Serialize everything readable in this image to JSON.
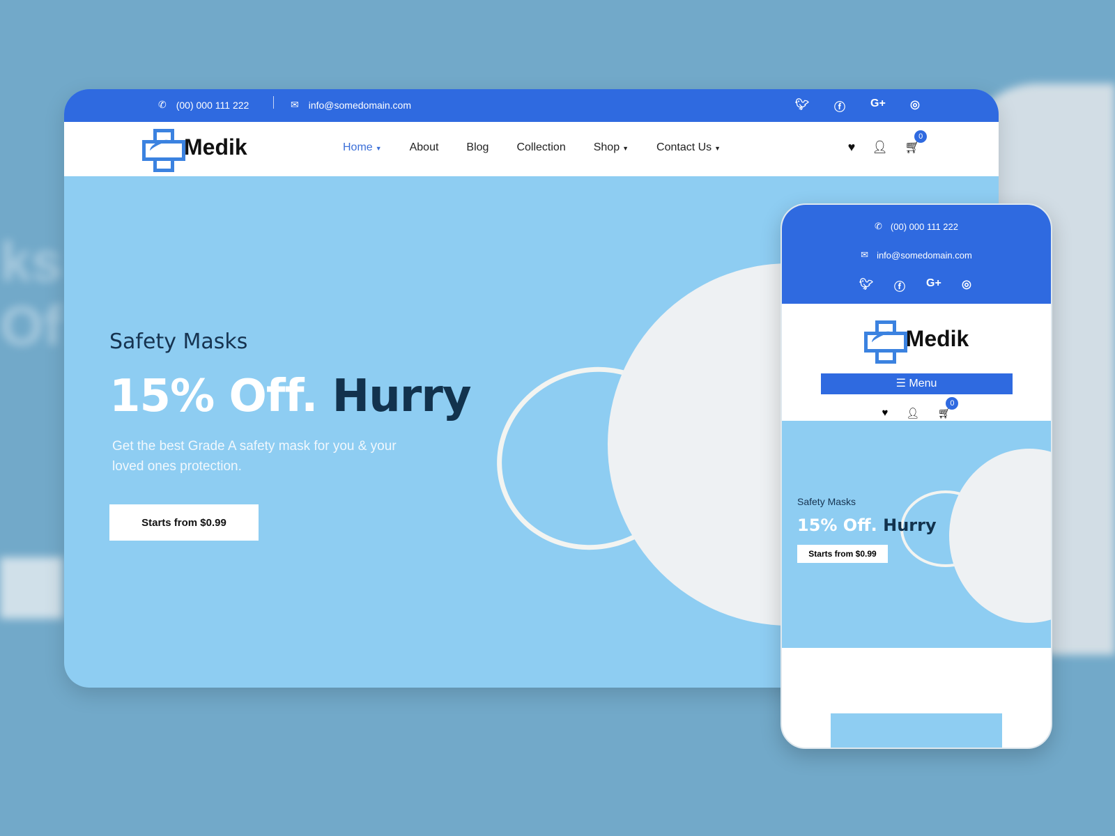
{
  "contact": {
    "phone": "(00) 000 111 222",
    "email": "info@somedomain.com"
  },
  "social": [
    "twitter-icon",
    "facebook-icon",
    "google-plus-icon",
    "instagram-icon"
  ],
  "social_glyphs": [
    "🐦",
    "f",
    "G+",
    "◎"
  ],
  "brand": {
    "name": "Medik",
    "color": "#2f6ae0"
  },
  "nav": {
    "items": [
      {
        "label": "Home",
        "caret": true
      },
      {
        "label": "About"
      },
      {
        "label": "Blog"
      },
      {
        "label": "Collection"
      },
      {
        "label": "Shop",
        "caret": true
      },
      {
        "label": "Contact Us",
        "caret": true
      }
    ]
  },
  "cart": {
    "count": "0"
  },
  "hero": {
    "eyebrow": "Safety Masks",
    "headline_light": "15% Off.",
    "headline_dark": "Hurry",
    "description": "Get the best Grade A safety mask for you & your loved ones protection.",
    "cta": "Starts from $0.99"
  },
  "mobile": {
    "menu_label": "Menu"
  }
}
